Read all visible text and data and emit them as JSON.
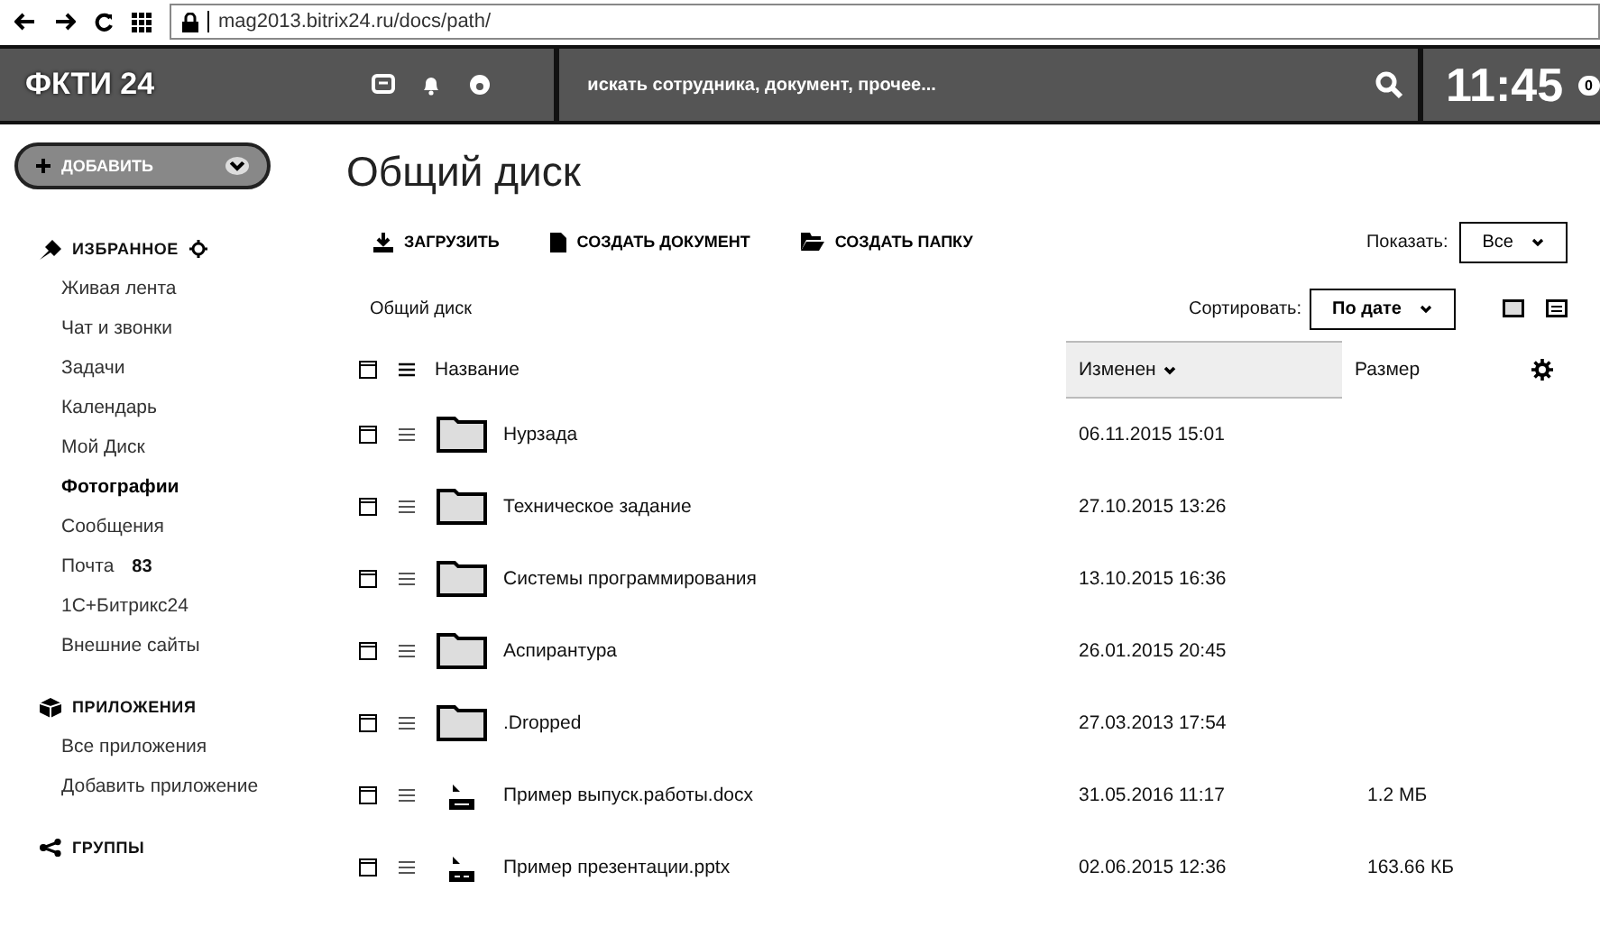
{
  "browser": {
    "url": "mag2013.bitrix24.ru/docs/path/"
  },
  "header": {
    "logo": "ФКТИ 24",
    "search": {
      "placeholder": "искать сотрудника, документ, прочее..."
    },
    "clock": "11:45",
    "clock_badge": "0"
  },
  "add_button": "ДОБАВИТЬ",
  "page_title": "Общий диск",
  "sidebar": {
    "sections": [
      {
        "title": "ИЗБРАННОЕ",
        "items": [
          {
            "label": "Живая лента",
            "selected": false
          },
          {
            "label": "Чат и звонки",
            "selected": false
          },
          {
            "label": "Задачи",
            "selected": false
          },
          {
            "label": "Календарь",
            "selected": false
          },
          {
            "label": "Мой Диск",
            "selected": false
          },
          {
            "label": "Фотографии",
            "selected": true
          },
          {
            "label": "Сообщения",
            "selected": false
          },
          {
            "label": "Почта",
            "count": "83",
            "selected": false
          },
          {
            "label": "1С+Битрикс24",
            "selected": false
          },
          {
            "label": "Внешние сайты",
            "selected": false
          }
        ]
      },
      {
        "title": "ПРИЛОЖЕНИЯ",
        "items": [
          {
            "label": "Все приложения",
            "selected": false
          },
          {
            "label": "Добавить приложение",
            "selected": false
          }
        ]
      },
      {
        "title": "ГРУППЫ"
      }
    ]
  },
  "toolbar": {
    "actions": [
      {
        "label": "ЗАГРУЗИТЬ"
      },
      {
        "label": "СОЗДАТЬ ДОКУМЕНТ"
      },
      {
        "label": "СОЗДАТЬ ПАПКУ"
      }
    ],
    "filter_label": "Показать:",
    "filter_value": "Все"
  },
  "breadcrumb": "Общий диск",
  "sort": {
    "label": "Сортировать:",
    "value": "По дате"
  },
  "table": {
    "columns": [
      {
        "label": "Название",
        "sorted": false
      },
      {
        "label": "Изменен",
        "sorted": true
      },
      {
        "label": "Размер",
        "sorted": false
      }
    ],
    "rows": [
      {
        "kind": "folder",
        "name": "Нурзада",
        "modified": "06.11.2015 15:01"
      },
      {
        "kind": "folder",
        "name": "Техническое задание",
        "modified": "27.10.2015 13:26"
      },
      {
        "kind": "folder",
        "name": "Системы программирования",
        "modified": "13.10.2015 16:36"
      },
      {
        "kind": "folder",
        "name": "Аспирантура",
        "modified": "26.01.2015 20:45"
      },
      {
        "kind": "folder",
        "name": ".Dropped",
        "modified": "27.03.2013 17:54"
      },
      {
        "kind": "docx",
        "name": "Пример выпуск.работы.docx",
        "modified": "31.05.2016 11:17",
        "size": "1.2 МБ"
      },
      {
        "kind": "pptx",
        "name": "Пример презентации.pptx",
        "modified": "02.06.2015 12:36",
        "size": "163.66 КБ"
      }
    ]
  }
}
